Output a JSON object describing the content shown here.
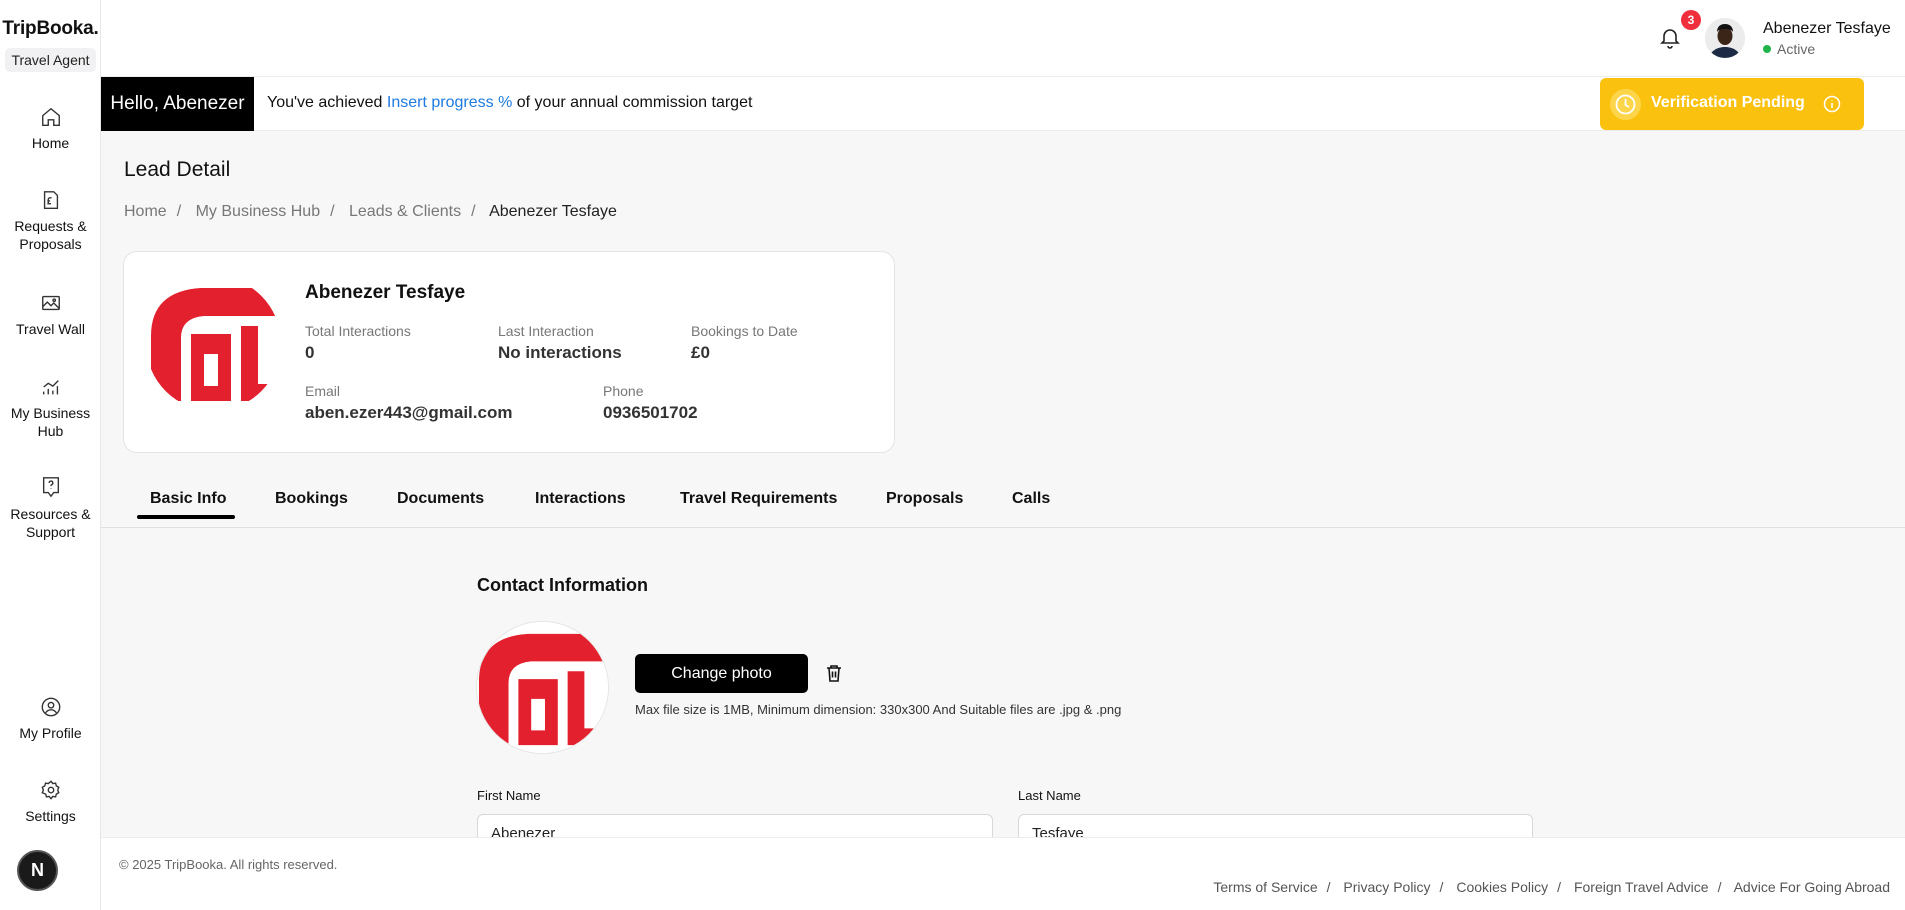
{
  "brand": {
    "name": "TripBooka.",
    "role": "Travel Agent"
  },
  "sidebar": {
    "items": [
      {
        "id": "home",
        "label": "Home"
      },
      {
        "id": "requests",
        "label": "Requests & Proposals"
      },
      {
        "id": "travel-wall",
        "label": "Travel Wall"
      },
      {
        "id": "business-hub",
        "label": "My Business Hub"
      },
      {
        "id": "resources",
        "label": "Resources & Support"
      },
      {
        "id": "profile",
        "label": "My Profile"
      },
      {
        "id": "settings",
        "label": "Settings"
      }
    ],
    "avatar_letter": "N"
  },
  "topbar": {
    "notifications_count": "3",
    "user_name": "Abenezer Tesfaye",
    "user_status": "Active"
  },
  "banner": {
    "hello": "Hello, Abenezer",
    "progress_prefix": "You've achieved",
    "progress_link": "Insert progress %",
    "progress_suffix": "of your annual commission target",
    "verification": "Verification Pending"
  },
  "page": {
    "title": "Lead Detail",
    "breadcrumb": [
      "Home",
      "My Business Hub",
      "Leads & Clients",
      "Abenezer Tesfaye"
    ]
  },
  "lead": {
    "name": "Abenezer Tesfaye",
    "total_interactions_label": "Total Interactions",
    "total_interactions": "0",
    "last_interaction_label": "Last Interaction",
    "last_interaction": "No interactions",
    "bookings_label": "Bookings to Date",
    "bookings": "£0",
    "email_label": "Email",
    "email": "aben.ezer443@gmail.com",
    "phone_label": "Phone",
    "phone": "0936501702"
  },
  "tabs": [
    "Basic Info",
    "Bookings",
    "Documents",
    "Interactions",
    "Travel Requirements",
    "Proposals",
    "Calls"
  ],
  "contact": {
    "title": "Contact Information",
    "change_photo": "Change photo",
    "file_hint": "Max file size is 1MB, Minimum dimension: 330x300 And Suitable files are .jpg & .png",
    "first_name_label": "First Name",
    "first_name": "Abenezer",
    "last_name_label": "Last Name",
    "last_name": "Tesfaye"
  },
  "footer": {
    "copyright": "© 2025 TripBooka. All rights reserved.",
    "links": [
      "Terms of Service",
      "Privacy Policy",
      "Cookies Policy",
      "Foreign Travel Advice",
      "Advice For Going Abroad"
    ]
  },
  "colors": {
    "accent": "#1e7be0",
    "verify": "#fbc10f",
    "badge": "#ef2f3c",
    "active": "#20b54a",
    "logo_red": "#e3202e"
  }
}
